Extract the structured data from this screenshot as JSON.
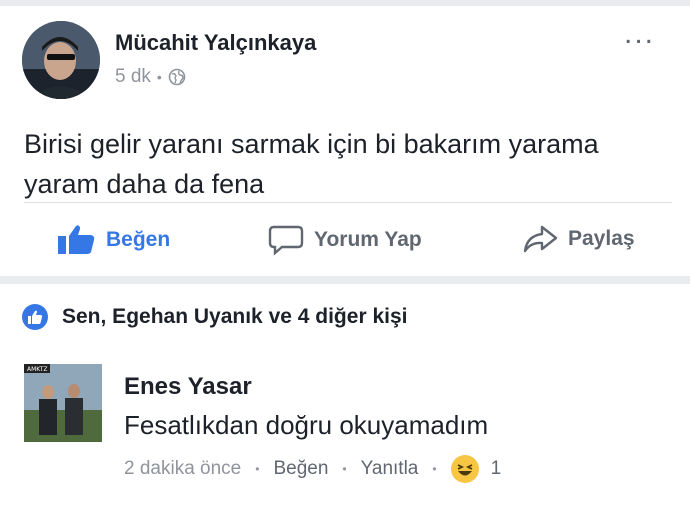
{
  "post": {
    "author": "Mücahit Yalçınkaya",
    "time": "5 dk",
    "more_label": "...",
    "text": "Birisi gelir yaranı sarmak için bi bakarım yarama yaram daha da fena"
  },
  "actions": {
    "like_label": "Beğen",
    "comment_label": "Yorum Yap",
    "share_label": "Paylaş"
  },
  "reactions": {
    "summary": "Sen, Egehan Uyanık ve 4 diğer kişi"
  },
  "comment": {
    "author": "Enes Yasar",
    "text": "Fesatlıkdan doğru okuyamadım",
    "time": "2 dakika önce",
    "like_label": "Beğen",
    "reply_label": "Yanıtla",
    "reaction_count": "1",
    "reaction_icon": "laughing-emoji-icon",
    "avatar_badge": "AMKTZ"
  },
  "colors": {
    "accent": "#3578e5",
    "muted": "#90949c",
    "text": "#1d2129"
  }
}
